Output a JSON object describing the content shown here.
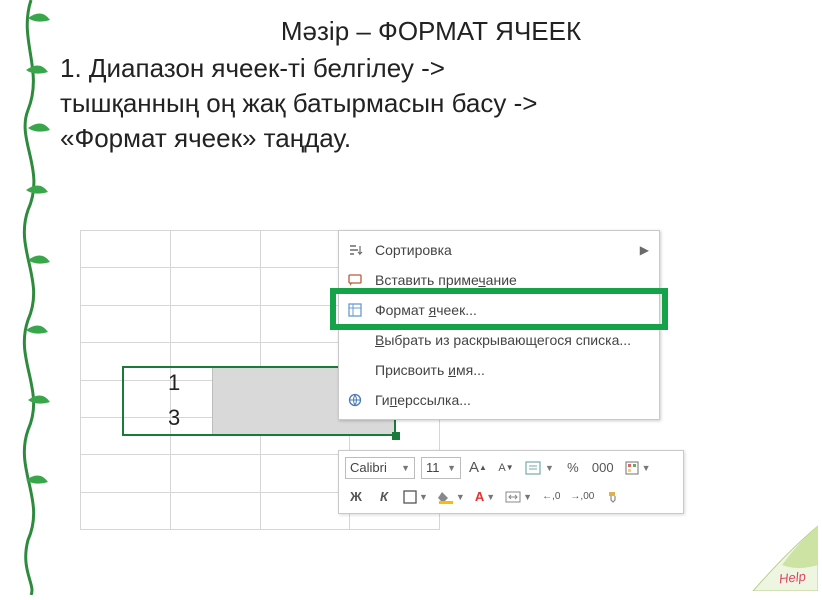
{
  "title": "Мәзір – ФОРМАТ ЯЧЕЕК",
  "instruction_line1": "1. Диапазон ячеек-ті белгілеу ->",
  "instruction_line2": "тышқанның оң жақ батырмасын басу ->",
  "instruction_line3": "«Формат ячеек» таңдау.",
  "cells": {
    "a1": "1",
    "a2": "3"
  },
  "context_menu": {
    "sort": "Сортировка",
    "insert_comment": "Вставить примечание",
    "format_cells": "Формат ячеек...",
    "pick_from_list": "Выбрать из раскрывающегося списка...",
    "define_name": "Присвоить имя...",
    "hyperlink": "Гиперссылка..."
  },
  "toolbar": {
    "font": "Calibri",
    "size": "11",
    "grow": "A",
    "shrink": "A",
    "bold": "Ж",
    "italic": "К",
    "percent": "%",
    "comma": "000",
    "inc_dec": ",0",
    "dec_dec": ",00"
  },
  "help": "Help"
}
